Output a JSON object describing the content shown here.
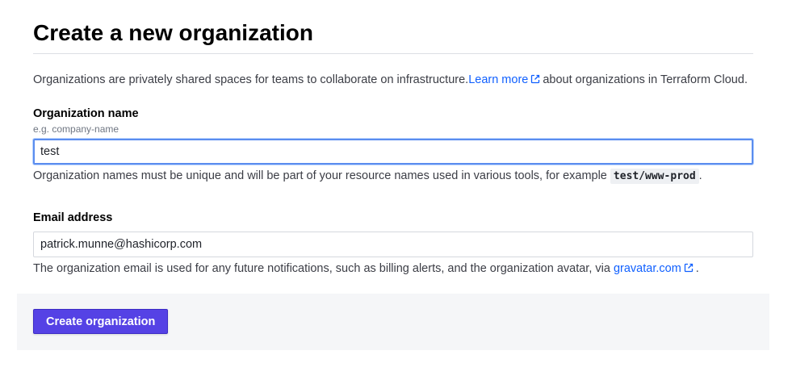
{
  "page": {
    "title": "Create a new organization"
  },
  "intro": {
    "text_before": "Organizations are privately shared spaces for teams to collaborate on infrastructure.",
    "link_label": "Learn more",
    "text_after": "about organizations in Terraform Cloud."
  },
  "org_name": {
    "label": "Organization name",
    "hint": "e.g. company-name",
    "value": "test",
    "help_text": "Organization names must be unique and will be part of your resource names used in various tools, for example",
    "example_code": "test/www-prod",
    "help_suffix": "."
  },
  "email": {
    "label": "Email address",
    "value": "patrick.munne@hashicorp.com",
    "help_text": "The organization email is used for any future notifications, such as billing alerts, and the organization avatar, via",
    "link_label": "gravatar.com",
    "help_suffix": "."
  },
  "actions": {
    "submit_label": "Create organization"
  },
  "colors": {
    "primary": "#5542e5",
    "link": "#1060ff",
    "focus": "#5b8def"
  }
}
